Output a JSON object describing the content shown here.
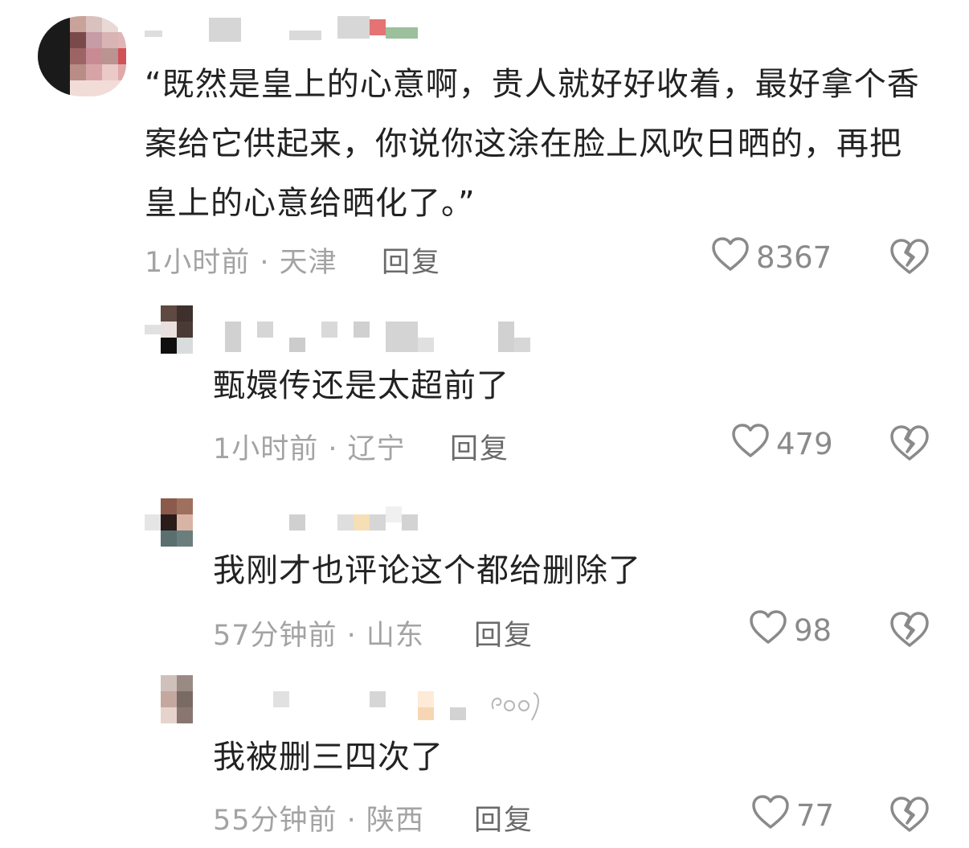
{
  "comments": [
    {
      "text": "“既然是皇上的心意啊，贵人就好好收着，最好拿个香案给它供起来，你说你这涂在脸上风吹日晒的，再把皇上的心意给晒化了。”",
      "meta": "1小时前 · 天津",
      "reply_label": "回复",
      "likes": "8367"
    },
    {
      "text": "甄嬛传还是太超前了",
      "meta": "1小时前 · 辽宁",
      "reply_label": "回复",
      "likes": "479"
    },
    {
      "text": "我刚才也评论这个都给删除了",
      "meta": "57分钟前 · 山东",
      "reply_label": "回复",
      "likes": "98"
    },
    {
      "text": "我被删三四次了",
      "meta": "55分钟前 · 陕西",
      "reply_label": "回复",
      "likes": "77"
    }
  ],
  "icons": {
    "like": "heart-outline-icon",
    "dislike": "broken-heart-icon"
  },
  "colors": {
    "text": "#222222",
    "meta": "#a3a3a3",
    "reply": "#6a6a6a",
    "icon": "#8a8a8a"
  }
}
